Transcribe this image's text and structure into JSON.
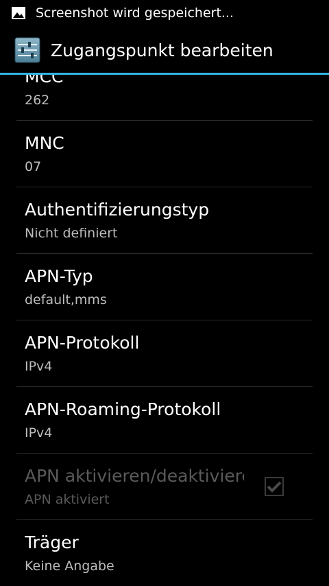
{
  "status_bar": {
    "notification_icon": "image-icon",
    "text": "Screenshot wird gespeichert..."
  },
  "action_bar": {
    "icon": "settings-sliders-icon",
    "title": "Zugangspunkt bearbeiten"
  },
  "preferences": [
    {
      "title": "MCC",
      "summary": "262"
    },
    {
      "title": "MNC",
      "summary": "07"
    },
    {
      "title": "Authentifizierungstyp",
      "summary": "Nicht definiert"
    },
    {
      "title": "APN-Typ",
      "summary": "default,mms"
    },
    {
      "title": "APN-Protokoll",
      "summary": "IPv4"
    },
    {
      "title": "APN-Roaming-Protokoll",
      "summary": "IPv4"
    },
    {
      "title": "APN aktivieren/deaktivieren",
      "summary": "APN aktiviert",
      "checked": true,
      "enabled": false
    },
    {
      "title": "Träger",
      "summary": "Keine Angabe"
    }
  ],
  "colors": {
    "accent": "#33b5e5",
    "background": "#000000",
    "summary_text": "#bdbdbd",
    "disabled_text": "#5a5a5a"
  }
}
